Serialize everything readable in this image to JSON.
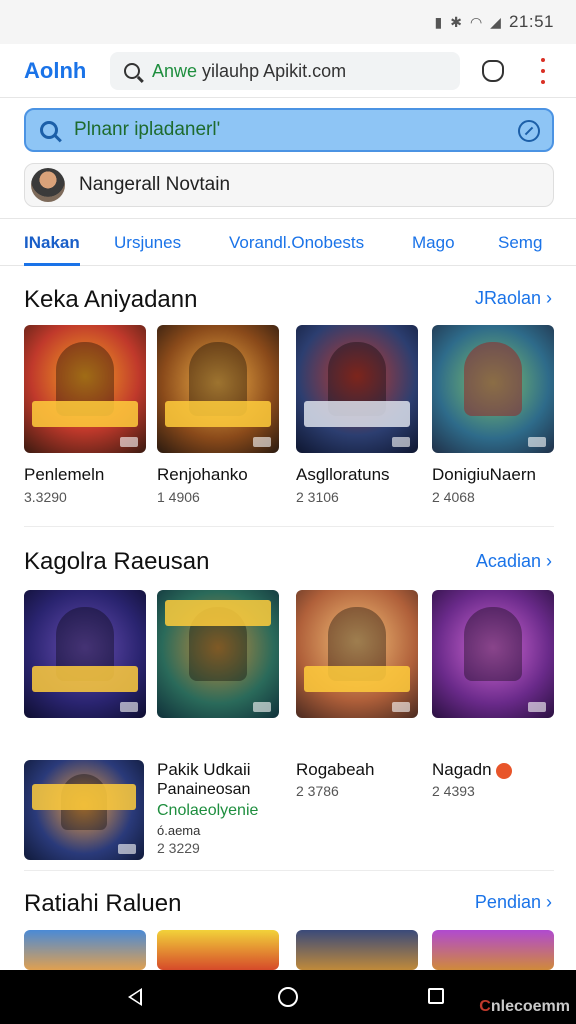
{
  "status_bar": {
    "time": "21:51",
    "icons": [
      "battery-icon",
      "bluetooth-icon",
      "wifi-icon",
      "signal-icon"
    ]
  },
  "header": {
    "logo": "Aolnh",
    "url_highlight": "Anwe",
    "url_rest": " yilauhp Apikit.com",
    "icons": [
      "search-icon",
      "shield-icon",
      "kebab-menu-icon"
    ]
  },
  "search": {
    "placeholder": "Plnanr ipladanerl'"
  },
  "account": {
    "name": "Nangerall Novtain"
  },
  "tabs": [
    {
      "label": "INakan",
      "active": true
    },
    {
      "label": "Ursjunes",
      "active": false
    },
    {
      "label": "Vorandl.Onobests",
      "active": false
    },
    {
      "label": "Mago",
      "active": false
    },
    {
      "label": "Semg",
      "active": false
    }
  ],
  "sections": [
    {
      "title": "Keka Aniyadann",
      "link": "JRaolan",
      "apps": [
        {
          "name": "Penlemeln",
          "meta": "3.3290"
        },
        {
          "name": "Renjohanko",
          "meta": "1 4906"
        },
        {
          "name": "Asglloratuns",
          "meta": "2 3106"
        },
        {
          "name": "DonigiuNaern",
          "meta": "2 4068"
        }
      ]
    },
    {
      "title": "Kagolra Raeusan",
      "link": "Acadian",
      "apps": [
        {
          "name": "",
          "meta": ""
        },
        {
          "name": "",
          "meta": ""
        },
        {
          "name": "Rogabeah",
          "meta": "2 3786"
        },
        {
          "name": "Nagadn",
          "meta": "2 4393"
        }
      ],
      "extra_app": {
        "name": "Pakik Udkaii",
        "sub": "Panaineosan",
        "promo": "Cnolaeolyenie",
        "note": "ó.aema",
        "meta": "2 3229"
      }
    },
    {
      "title": "Ratiahi Raluen",
      "link": "Pendian"
    }
  ],
  "colors": {
    "accent": "#1a73e8",
    "search_fill": "#8ec5f5",
    "nav_bar": "#000000"
  },
  "watermark": {
    "lead": "C",
    "rest": "nlecoemm"
  }
}
